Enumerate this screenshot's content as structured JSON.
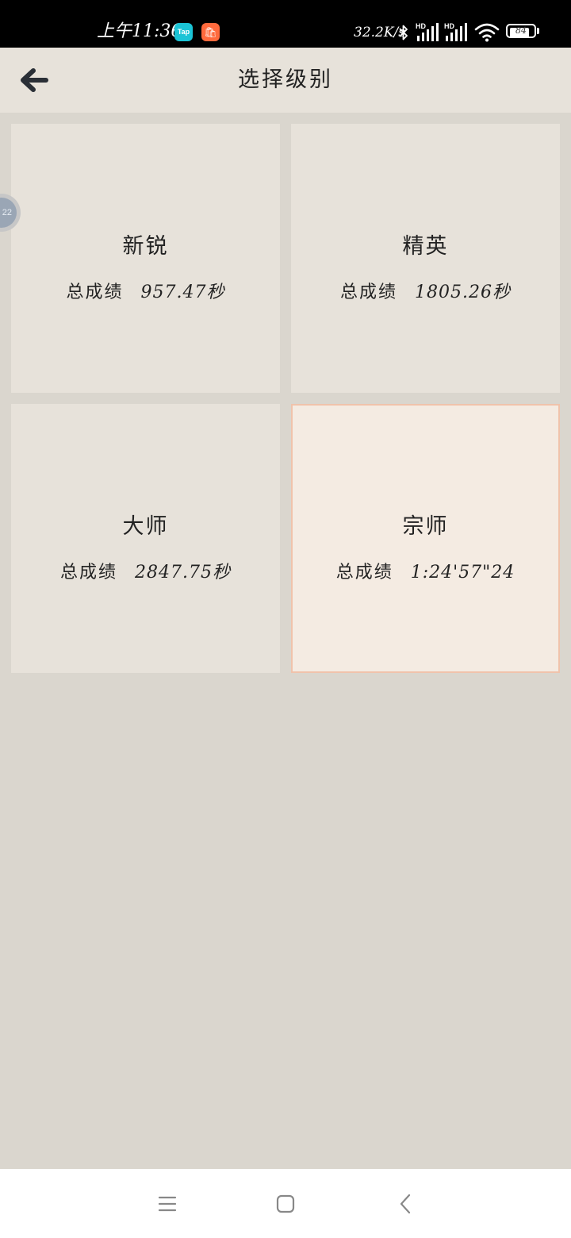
{
  "status_bar": {
    "time": "上午11:36",
    "apps": [
      {
        "icon": "taptap-icon",
        "label": "Tap"
      },
      {
        "icon": "shopping-bag-icon",
        "label": ""
      }
    ],
    "net_speed": "32.2K/s",
    "network_tags": [
      "HD",
      "HD"
    ],
    "battery": "84",
    "battery_level": 0.84
  },
  "header": {
    "back_icon": "arrow-left-icon",
    "title": "选择级别"
  },
  "levels": [
    {
      "name": "新锐",
      "score_label": "总成绩",
      "score": "957.47秒",
      "selected": false
    },
    {
      "name": "精英",
      "score_label": "总成绩",
      "score": "1805.26秒",
      "selected": false
    },
    {
      "name": "大师",
      "score_label": "总成绩",
      "score": "2847.75秒",
      "selected": false
    },
    {
      "name": "宗师",
      "score_label": "总成绩",
      "score": "1:24'57\"24",
      "selected": true
    }
  ],
  "float_bubble": {
    "label": "22"
  },
  "colors": {
    "background": "#dad6ce",
    "card": "#e7e2da",
    "card_selected": "#f4ebe2",
    "card_selected_border": "#f0c3ab",
    "text": "#222222"
  },
  "nav_bar": {
    "icons": [
      "menu-icon",
      "home-square-icon",
      "back-chevron-icon"
    ]
  }
}
